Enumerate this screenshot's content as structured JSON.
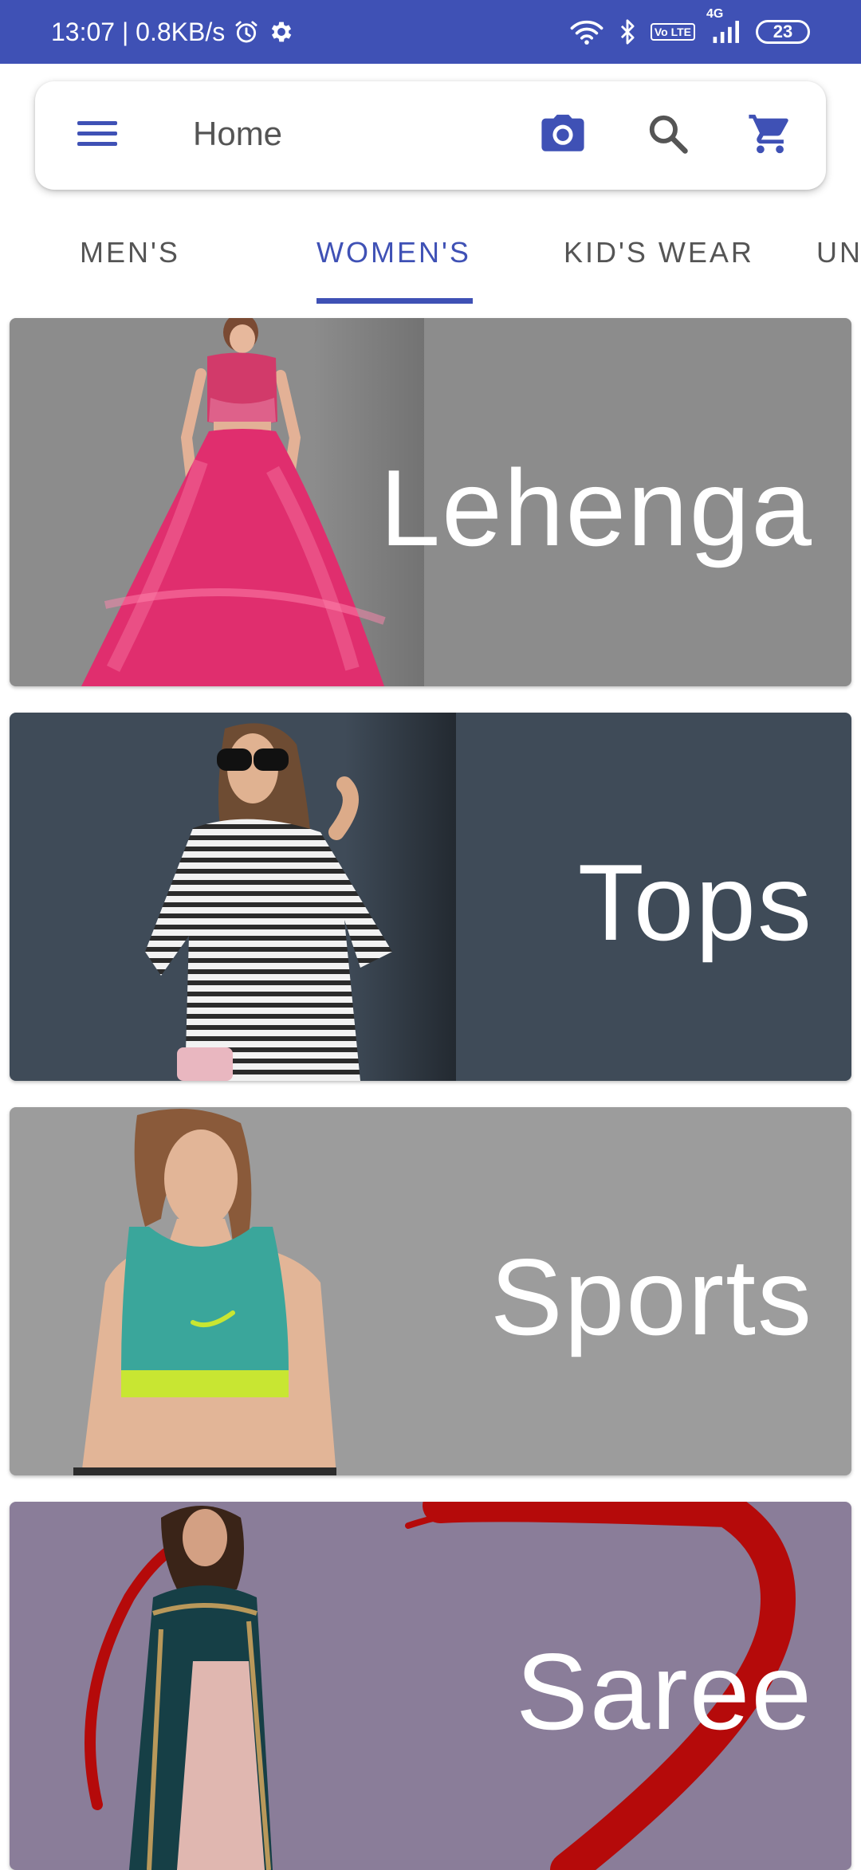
{
  "status_bar": {
    "time_speed": "13:07 | 0.8KB/s",
    "network_label": "4G",
    "volte_label": "Vo LTE",
    "battery": "23",
    "icons": [
      "alarm-icon",
      "settings-icon",
      "wifi-icon",
      "bluetooth-icon",
      "volte-icon",
      "signal-icon",
      "battery-icon"
    ]
  },
  "app_bar": {
    "title": "Home",
    "icons": [
      "menu-icon",
      "camera-icon",
      "search-icon",
      "cart-icon"
    ]
  },
  "tabs": [
    {
      "label": "MEN'S",
      "active": false
    },
    {
      "label": "WOMEN'S",
      "active": true
    },
    {
      "label": "KID'S WEAR",
      "active": false
    },
    {
      "label": "UN",
      "active": false
    }
  ],
  "categories": [
    {
      "label": "Lehenga",
      "background": "#8C8C8C"
    },
    {
      "label": "Tops",
      "background": "#3F4B58"
    },
    {
      "label": "Sports",
      "background": "#9C9C9C"
    },
    {
      "label": "Saree",
      "background": "#8A7D99"
    }
  ],
  "colors": {
    "primary": "#3F51B5",
    "tab_text": "#555555",
    "card_text": "#FFFFFF"
  }
}
